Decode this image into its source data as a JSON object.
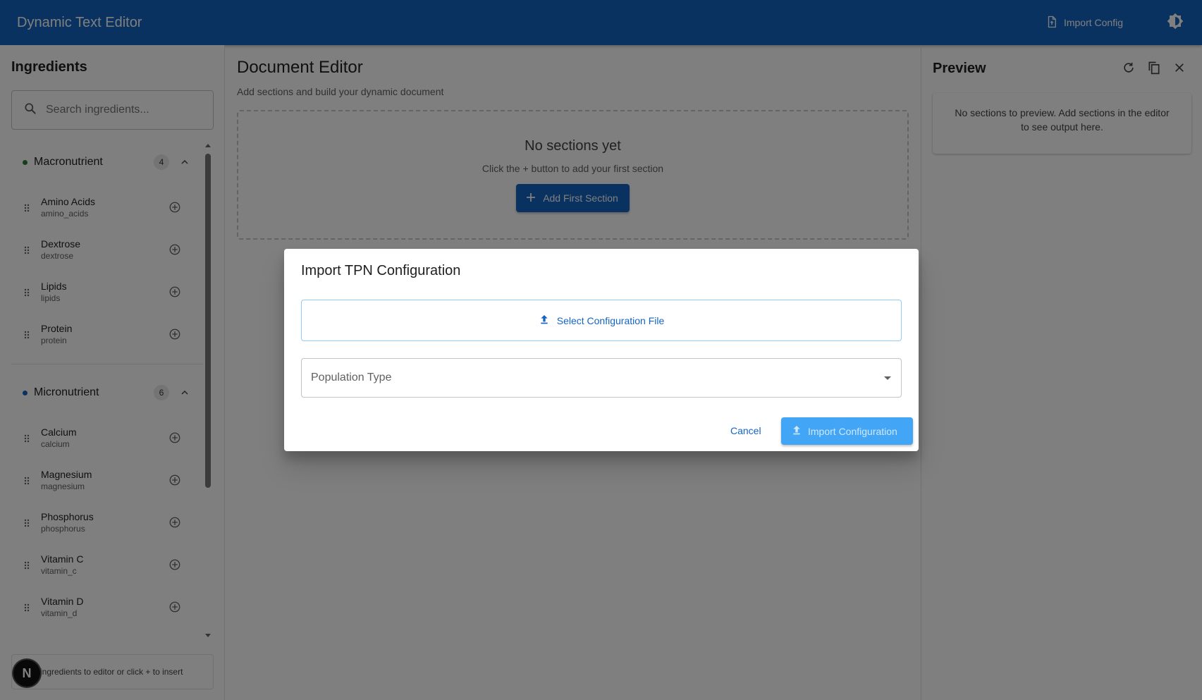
{
  "appbar": {
    "title": "Dynamic Text Editor",
    "import_label": "Import Config",
    "theme_icon": "brightness-icon"
  },
  "sidebar": {
    "title": "Ingredients",
    "search_placeholder": "Search ingredients...",
    "groups": [
      {
        "name": "Macronutrient",
        "count": "4",
        "color": "#2e7d32",
        "items": [
          {
            "name": "Amino Acids",
            "key": "amino_acids"
          },
          {
            "name": "Dextrose",
            "key": "dextrose"
          },
          {
            "name": "Lipids",
            "key": "lipids"
          },
          {
            "name": "Protein",
            "key": "protein"
          }
        ]
      },
      {
        "name": "Micronutrient",
        "count": "6",
        "color": "#1565c0",
        "items": [
          {
            "name": "Calcium",
            "key": "calcium"
          },
          {
            "name": "Magnesium",
            "key": "magnesium"
          },
          {
            "name": "Phosphorus",
            "key": "phosphorus"
          },
          {
            "name": "Vitamin C",
            "key": "vitamin_c"
          },
          {
            "name": "Vitamin D",
            "key": "vitamin_d"
          }
        ]
      }
    ],
    "hint": "ingredients to editor or click + to insert",
    "badge_letter": "N"
  },
  "editor": {
    "title": "Document Editor",
    "subtitle": "Add sections and build your dynamic document",
    "empty_title": "No sections yet",
    "empty_desc": "Click the + button to add your first section",
    "add_first_label": "Add First Section"
  },
  "preview": {
    "title": "Preview",
    "empty_text": "No sections to preview. Add sections in the editor to see output here."
  },
  "dialog": {
    "title": "Import TPN Configuration",
    "select_file_label": "Select Configuration File",
    "population_label": "Population Type",
    "cancel_label": "Cancel",
    "import_label": "Import Configuration"
  },
  "colors": {
    "primary": "#1565c0",
    "primary_light": "#42a5f5",
    "macro_dot": "#2e7d32",
    "micro_dot": "#1565c0"
  }
}
